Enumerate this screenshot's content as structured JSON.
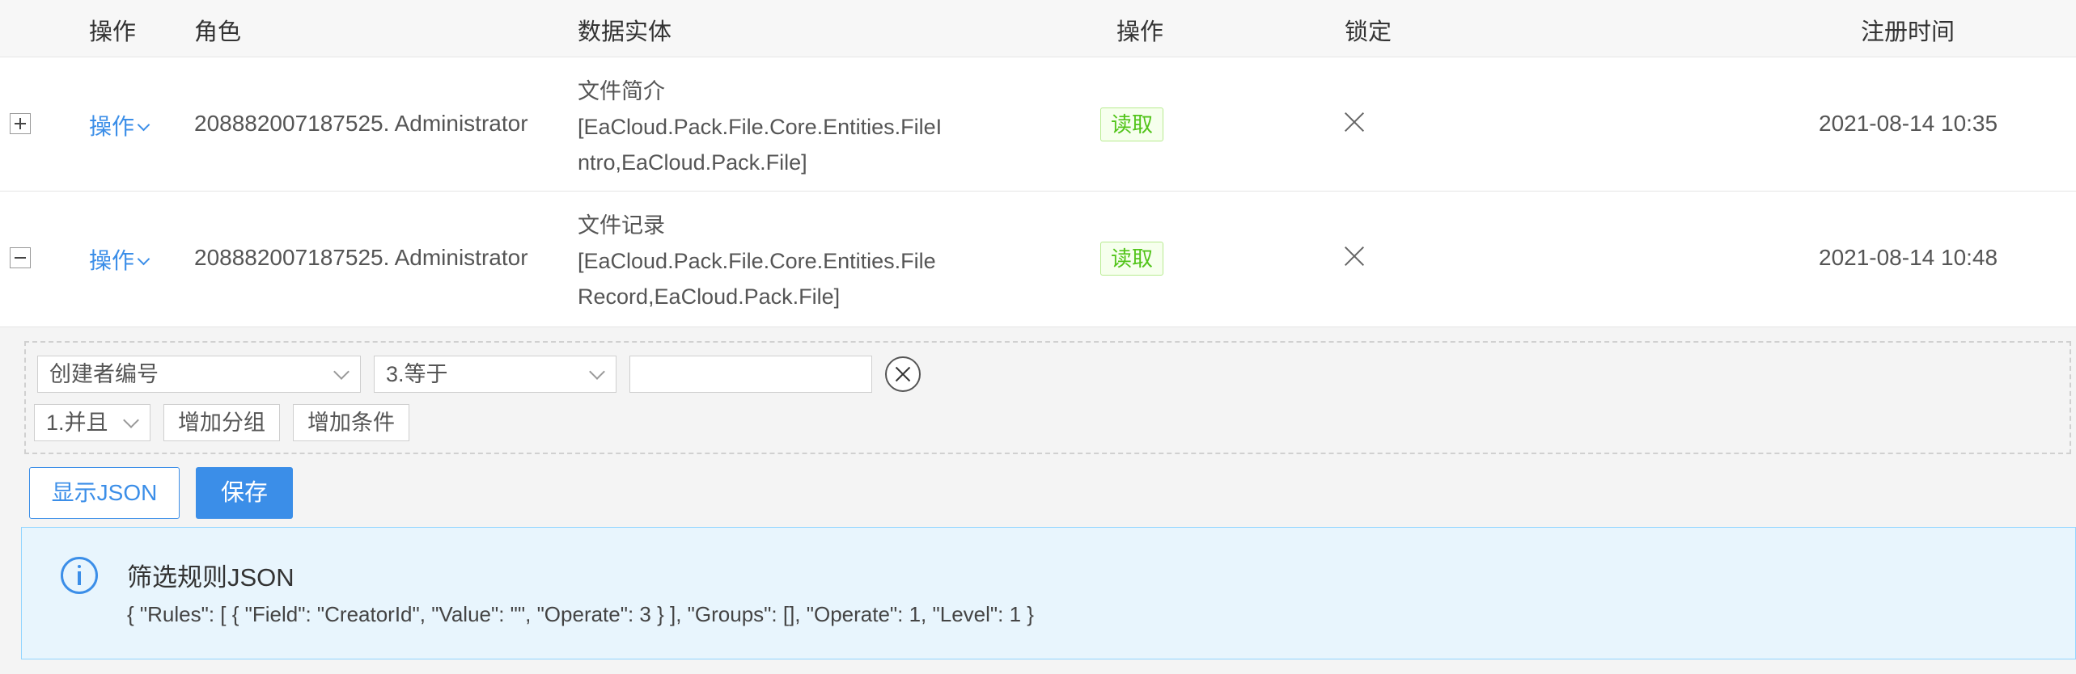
{
  "table": {
    "headers": {
      "op": "操作",
      "role": "角色",
      "entity": "数据实体",
      "operate": "操作",
      "lock": "锁定",
      "register_time": "注册时间"
    },
    "rows": [
      {
        "expand": "+",
        "action": "操作",
        "role": "208882007187525. Administrator",
        "entity_name": "文件简介",
        "entity_type_line1": "[EaCloud.Pack.File.Core.Entities.FileI",
        "entity_type_line2": "ntro,EaCloud.Pack.File]",
        "operate_tag": "读取",
        "locked_icon": "close-icon",
        "time": "2021-08-14 10:35"
      },
      {
        "expand": "−",
        "action": "操作",
        "role": "208882007187525. Administrator",
        "entity_name": "文件记录",
        "entity_type_line1": "[EaCloud.Pack.File.Core.Entities.File",
        "entity_type_line2": "Record,EaCloud.Pack.File]",
        "operate_tag": "读取",
        "locked_icon": "close-icon",
        "time": "2021-08-14 10:48"
      }
    ]
  },
  "filter": {
    "field_select": "创建者编号",
    "operator_select": "3.等于",
    "value_input": "",
    "group_operator_select": "1.并且",
    "add_group_label": "增加分组",
    "add_condition_label": "增加条件"
  },
  "actions": {
    "show_json_label": "显示JSON",
    "save_label": "保存"
  },
  "alert": {
    "title": "筛选规则JSON",
    "json_text": "{ \"Rules\": [ { \"Field\": \"CreatorId\", \"Value\": \"\", \"Operate\": 3 } ], \"Groups\": [], \"Operate\": 1, \"Level\": 1 }"
  },
  "colors": {
    "primary": "#3b8ee8",
    "tag_green": "#52c41a",
    "alert_bg": "#e8f5fd"
  }
}
